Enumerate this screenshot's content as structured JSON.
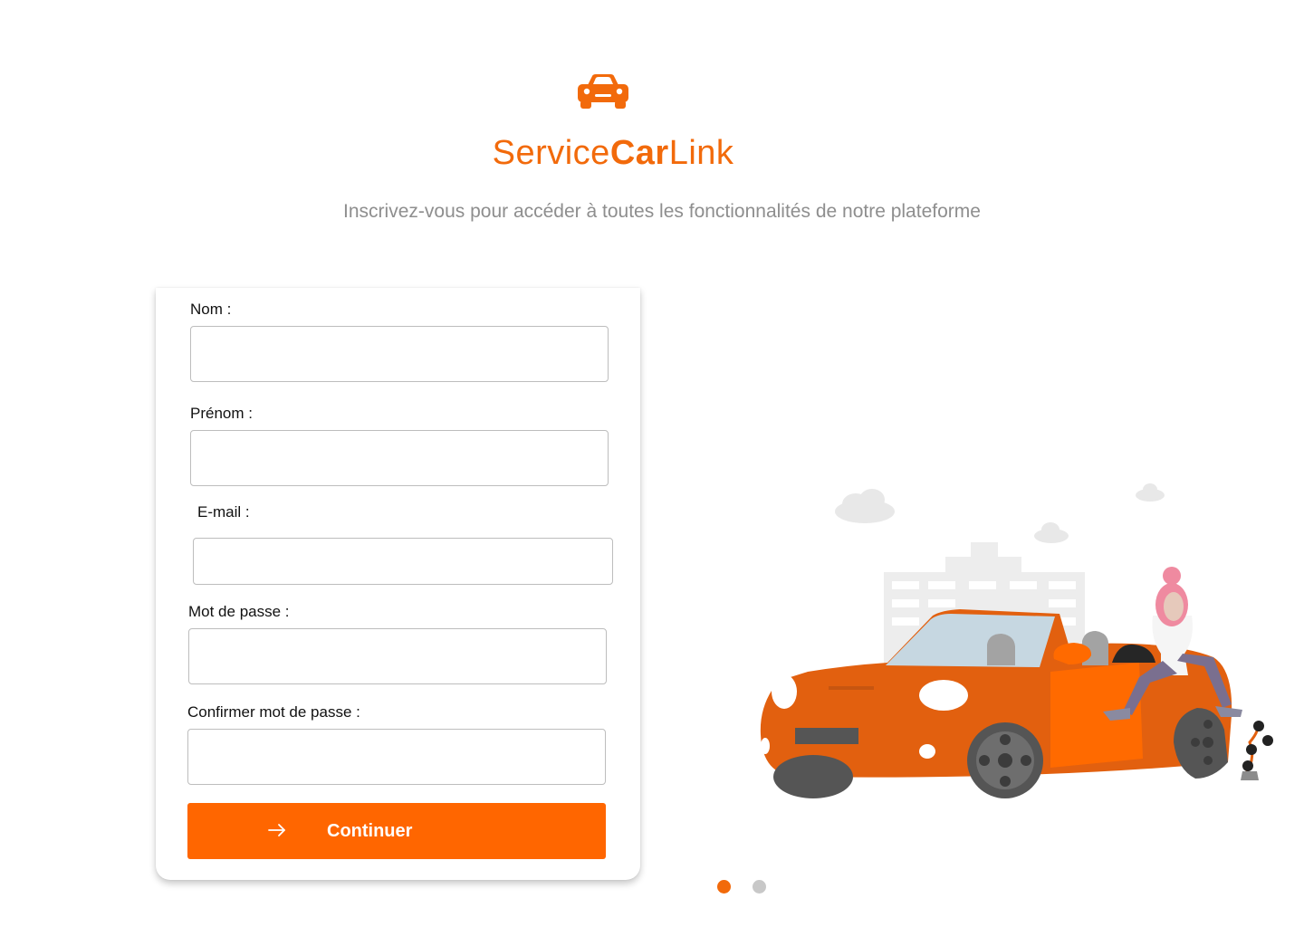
{
  "brand": {
    "prefix": "Service",
    "bold": "Car",
    "suffix": "Link",
    "logo_icon": "car-icon",
    "color": "#f26a0b"
  },
  "tagline": "Inscrivez-vous pour accéder à toutes les fonctionnalités de notre plateforme",
  "form": {
    "fields": [
      {
        "label": "Nom :",
        "value": "",
        "placeholder": ""
      },
      {
        "label": "Prénom :",
        "value": "",
        "placeholder": ""
      },
      {
        "label": "E-mail :",
        "value": "",
        "placeholder": ""
      },
      {
        "label": "Mot de passe :",
        "value": "",
        "placeholder": ""
      },
      {
        "label": "Confirmer mot de passe  :",
        "value": "",
        "placeholder": ""
      }
    ],
    "submit": {
      "label": "Continuer",
      "icon": "arrow-right-icon",
      "color": "#ff6600"
    }
  },
  "illustration": {
    "icon": "convertible-car-woman-illustration",
    "accent": "#e2600f"
  },
  "carousel": {
    "dots": [
      {
        "active": true,
        "color": "#f26a0b"
      },
      {
        "active": false,
        "color": "#c8c8c8"
      }
    ]
  }
}
